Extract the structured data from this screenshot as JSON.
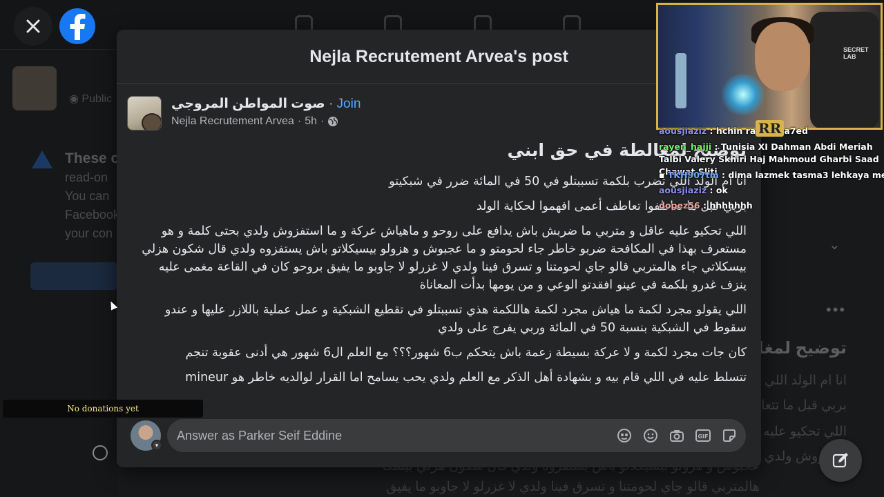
{
  "background": {
    "visibility": "Public",
    "notice_title": "These c",
    "notice_lines": [
      "read-on",
      "You can",
      "Facebook",
      "your con"
    ],
    "right_title": "توضيح لمغا",
    "right_lines": [
      "انا ام الولد اللي",
      "بربي قبل ما تتعا",
      "اللي تحكيو عليه",
      "ستفزوش ولدي"
    ],
    "bottom_lines": [
      "عجبوش و هزولو بيسيكلاتو باش يستفزوه ولدي قال شكون هزلي بيسكلاتي جاء",
      "هالمتربي قالو جاي لحومتنا و تسرق فينا ولدي لا غزرلو لا جاوبو ما يفيق بروحو كان في"
    ]
  },
  "dialog": {
    "title": "Nejla Recrutement Arvea's post"
  },
  "post": {
    "group_name": "صوت المواطن المروجي",
    "join_label": "Join",
    "author": "Nejla Recrutement Arvea",
    "time": "5h",
    "heading": "توضيح لمغالطة في حق ابني",
    "paragraphs": [
      "انا ام الولد اللي تضرب بلكمة تسببتلو في 50 في المائة ضرر في شبكيتو",
      "بربي قبل ما تعاطفوا تعاطف أعمى افهموا لحكاية الولد",
      "اللي تحكيو عليه عاقل و متربي ما ضربش باش يدافع على روحو و ماهياش عركة و ما استفزوش ولدي بحتى كلمة و هو مستعرف بهذا في المكافحة ضربو خاطر جاء لحومتو و ما عجبوش و هزولو بيسيكلاتو باش يستفزوه ولدي قال شكون هزلي بيسكلاتي جاء هالمتربي قالو جاي لحومتنا و تسرق فينا ولدي لا غزرلو لا جاوبو ما يفيق بروحو كان في القاعة مغمى عليه ينزف غدرو بلكمة في عينو افقدتو الوعي و من يومها بدأت المعاناة",
      "اللي يقولو مجرد لكمة ما هياش مجرد لكمة هاللكمة هذي تسببتلو في تقطيع الشبكية و عمل عملية باللازر عليها و عندو سقوط في الشبكية بنسبة 50 في المائة وربي يفرج على ولدي",
      "كان جات مجرد لكمة و لا عركة بسيطة زعمة باش يتحكم ب6 شهور؟؟؟ مع العلم ال6 شهور هي أدنى عقوبة تنجم",
      "تتسلط عليه في اللي قام بيه و بشهادة أهل الذكر مع العلم ولدي يحب يسامح اما القرار لوالديه خاطر هو mineur"
    ]
  },
  "comment": {
    "placeholder": "Answer as Parker Seif Eddine"
  },
  "stream": {
    "webcam_brand": "SECRET LAB",
    "webcam_logo": "RR",
    "chat": [
      {
        "user": "aousjiaziz",
        "text": "hchin rabyy wa7ed"
      },
      {
        "user": "rayen_hajji",
        "text": "Tunisia XI Dahman Abdi Meriah Talbi Valery Skhiri Haj Mahmoud Gharbi Saad Chawat Sliti"
      },
      {
        "user": "TKH907tm",
        "text": "dima lazmek tasma3 lehkaya mel chirtin"
      },
      {
        "user": "aousjiaziz",
        "text": "ok"
      },
      {
        "user": "dopez56",
        "text": "hhhhhhh"
      }
    ],
    "chat_colors": {
      "rayen_hajji": "#6cf36c",
      "TKH907tm": "#6fa8ff",
      "default": "#8f8ff0"
    },
    "donations": "No donations yet"
  },
  "icons": [
    "close-icon",
    "facebook-logo-icon",
    "globe-icon",
    "avatar-icon",
    "emoji-icon",
    "camera-icon",
    "gif-icon",
    "sticker-icon",
    "edit-icon"
  ],
  "colors": {
    "accent": "#1877f2",
    "join": "#5aa7ff",
    "dialog_bg": "#242526",
    "overlay_border": "#d8b24a"
  }
}
